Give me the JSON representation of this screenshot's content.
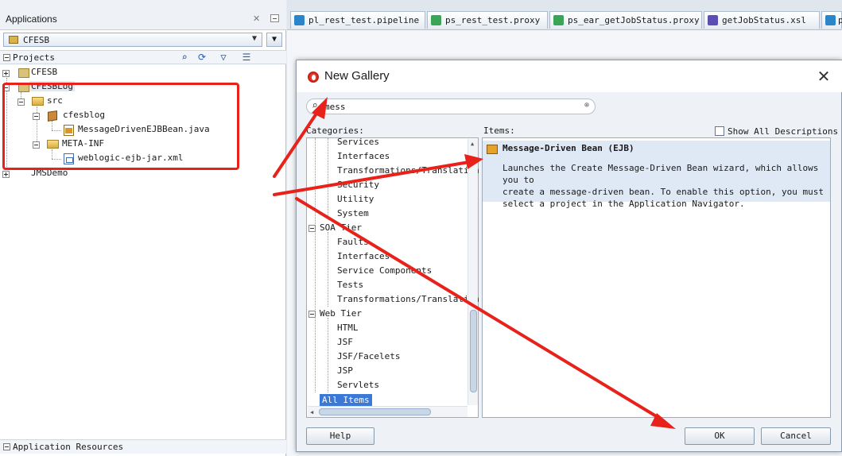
{
  "app_panel": {
    "title": "Applications",
    "selected_app": "CFESB",
    "projects_label": "Projects",
    "resources_label": "Application Resources",
    "tree": [
      {
        "label": "CFESB"
      },
      {
        "label": "CFESBLog"
      },
      {
        "label": "src"
      },
      {
        "label": "cfesblog"
      },
      {
        "label": "MessageDrivenEJBBean.java"
      },
      {
        "label": "META-INF"
      },
      {
        "label": "weblogic-ejb-jar.xml"
      },
      {
        "label": "JMSDemo"
      }
    ]
  },
  "editor_tabs": [
    {
      "label": "pl_rest_test.pipeline"
    },
    {
      "label": "ps_rest_test.proxy"
    },
    {
      "label": "ps_ear_getJobStatus.proxy"
    },
    {
      "label": "getJobStatus.xsl"
    },
    {
      "label": "p"
    }
  ],
  "dialog": {
    "title": "New Gallery",
    "search_value": "mess",
    "categories_label": "Categories:",
    "items_label": "Items:",
    "show_all_label": "Show All Descriptions",
    "categories": [
      "Services",
      "Interfaces",
      "Transformations/Translation",
      "Security",
      "Utility",
      "System",
      "SOA Tier",
      "Faults",
      "Interfaces",
      "Service Components",
      "Tests",
      "Transformations/Translation",
      "Web Tier",
      "HTML",
      "JSF",
      "JSF/Facelets",
      "JSP",
      "Servlets",
      "All Items"
    ],
    "item": {
      "title": "Message-Driven Bean (EJB)",
      "description": "Launches the Create Message-Driven Bean wizard, which allows you to\ncreate a message-driven bean. To enable this option, you must\nselect a project in the Application Navigator."
    },
    "buttons": {
      "help": "Help",
      "ok": "OK",
      "cancel": "Cancel"
    }
  },
  "colors": {
    "annotation_red": "#e8221b",
    "selection_blue": "#3c78d6"
  }
}
